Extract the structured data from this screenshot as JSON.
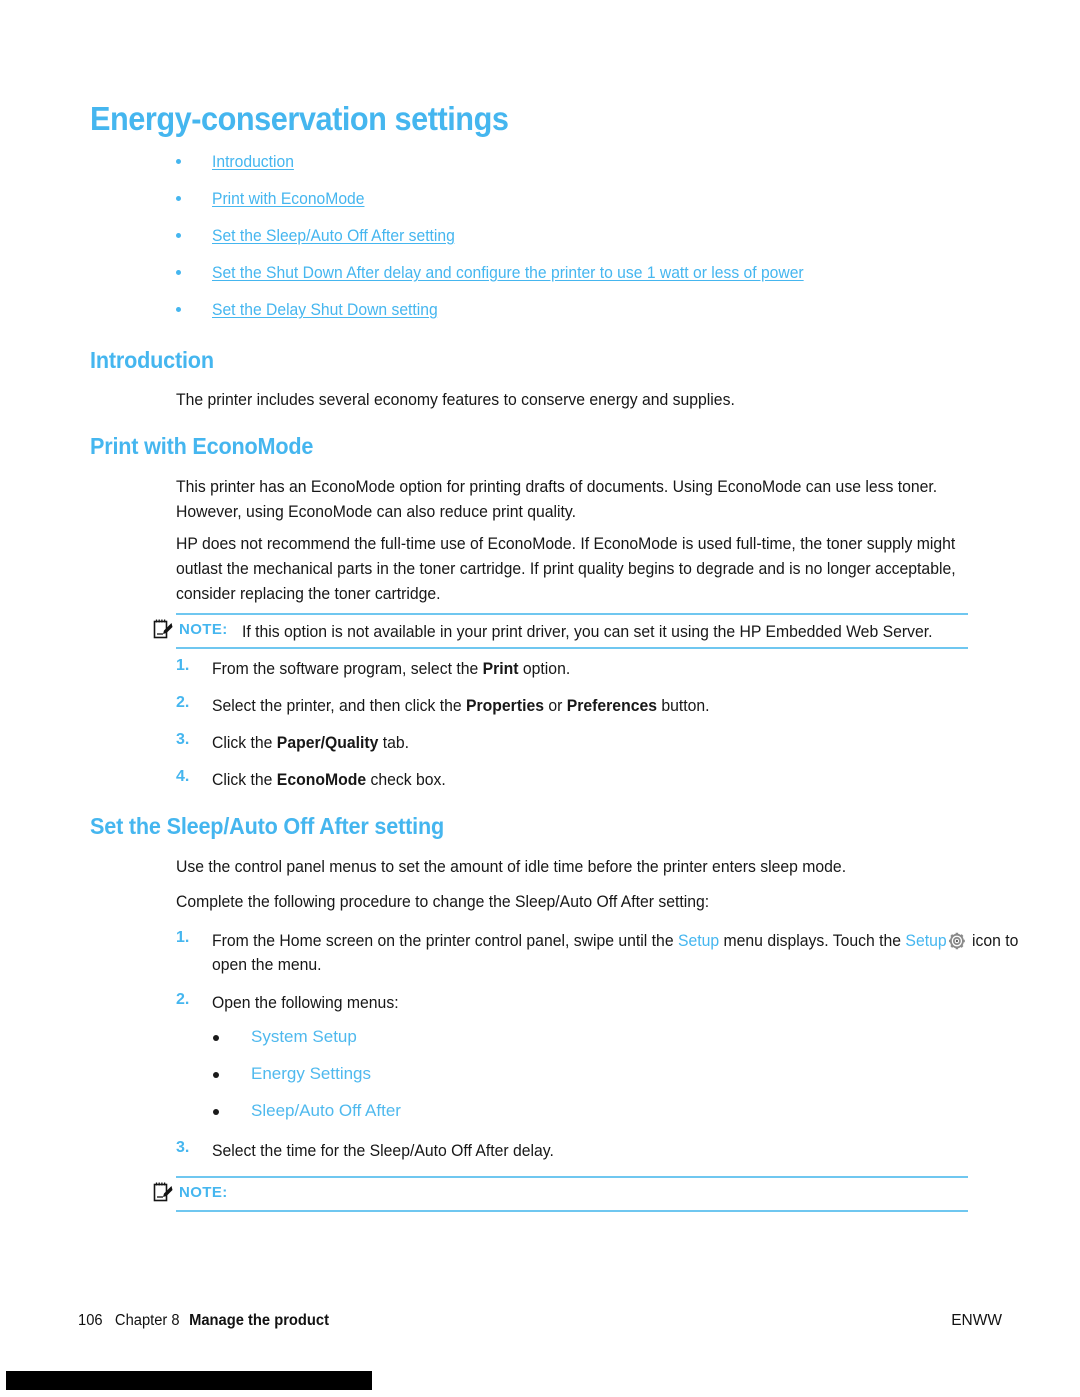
{
  "page": {
    "title": "Energy-conservation settings",
    "number": "106",
    "chapter": "Chapter 8",
    "section": "Manage the product",
    "locale_code": "ENWW",
    "accent_color": "#45B6EF",
    "note_rule_color": "#6FC7F0",
    "body_color": "#171717"
  },
  "toc": {
    "items": [
      {
        "label": "Introduction"
      },
      {
        "label": "Print with EconoMode"
      },
      {
        "label": "Set the Sleep/Auto Off After setting"
      },
      {
        "label": "Set the Shut Down After delay and configure the printer to use 1 watt or less of power"
      },
      {
        "label": "Set the Delay Shut Down setting"
      }
    ]
  },
  "sections": {
    "introduction": {
      "heading": "Introduction",
      "paragraph": "The printer includes several economy features to conserve energy and supplies."
    },
    "economode": {
      "heading": "Print with EconoMode",
      "paragraph1": "This printer has an EconoMode option for printing drafts of documents. Using EconoMode can use less toner. However, using EconoMode can also reduce print quality.",
      "paragraph2": "HP does not recommend the full-time use of EconoMode. If EconoMode is used full-time, the toner supply might outlast the mechanical parts in the toner cartridge. If print quality begins to degrade and is no longer acceptable, consider replacing the toner cartridge.",
      "note": {
        "label": "NOTE:",
        "text": "If this option is not available in your print driver, you can set it using the HP Embedded Web Server."
      },
      "steps": [
        {
          "num": "1.",
          "pre": "From the software program, select the ",
          "bold": "Print",
          "post": " option."
        },
        {
          "num": "2.",
          "pre": "Select the printer, and then click the ",
          "bold": "Properties",
          "mid": " or ",
          "bold2": "Preferences",
          "post": " button."
        },
        {
          "num": "3.",
          "pre": "Click the ",
          "bold": "Paper/Quality",
          "post": " tab."
        },
        {
          "num": "4.",
          "pre": "Click the ",
          "bold": "EconoMode",
          "post": " check box."
        }
      ]
    },
    "sleep": {
      "heading": "Set the Sleep/Auto Off After setting",
      "paragraph1": "Use the control panel menus to set the amount of idle time before the printer enters sleep mode.",
      "paragraph2": "Complete the following procedure to change the Sleep/Auto Off After setting:",
      "step1": {
        "num": "1.",
        "part1": "From the Home screen on the printer control panel, swipe until the ",
        "link1": "Setup",
        "part2": " menu displays. Touch the ",
        "link2": "Setup",
        "icon": "gear-icon",
        "part3": " icon to open the menu."
      },
      "step2": {
        "num": "2.",
        "text": "Open the following menus:"
      },
      "menus": [
        {
          "label": "System Setup"
        },
        {
          "label": "Energy Settings"
        },
        {
          "label": "Sleep/Auto Off After"
        }
      ],
      "step3": {
        "num": "3.",
        "text": "Select the time for the Sleep/Auto Off After delay."
      },
      "note": {
        "label": "NOTE:",
        "text": ""
      }
    }
  }
}
